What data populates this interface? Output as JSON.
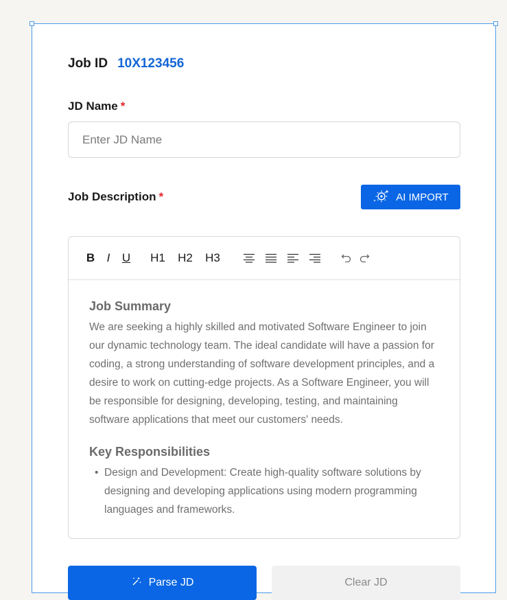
{
  "job": {
    "id_label": "Job ID",
    "id_value": "10X123456"
  },
  "jd_name": {
    "label": "JD Name",
    "required_mark": "*",
    "placeholder": "Enter JD Name",
    "value": ""
  },
  "job_description": {
    "label": "Job Description",
    "required_mark": "*",
    "ai_import_label": "AI IMPORT"
  },
  "toolbar": {
    "bold": "B",
    "italic": "I",
    "underline": "U",
    "h1": "H1",
    "h2": "H2",
    "h3": "H3",
    "icons": [
      "align-center-icon",
      "align-justify-icon",
      "align-left-icon",
      "align-right-icon",
      "undo-icon",
      "redo-icon"
    ]
  },
  "editor": {
    "section1_title": "Job Summary",
    "section1_body": "We are seeking a highly skilled and motivated Software Engineer to join our dynamic technology team. The ideal candidate will have a passion for coding, a strong understanding of software development principles, and a desire to work on cutting-edge projects. As a Software Engineer, you will be responsible for designing, developing, testing, and maintaining software applications that meet our customers' needs.",
    "section2_title": "Key Responsibilities",
    "responsibilities": [
      "Design and Development: Create high-quality software solutions by designing and developing applications using modern programming languages and frameworks."
    ]
  },
  "actions": {
    "parse_label": "Parse JD",
    "clear_label": "Clear JD"
  },
  "colors": {
    "primary": "#0a66e4",
    "job_id_value": "#1366d6",
    "required": "#e0262b",
    "selection_border": "#4a9be8"
  }
}
